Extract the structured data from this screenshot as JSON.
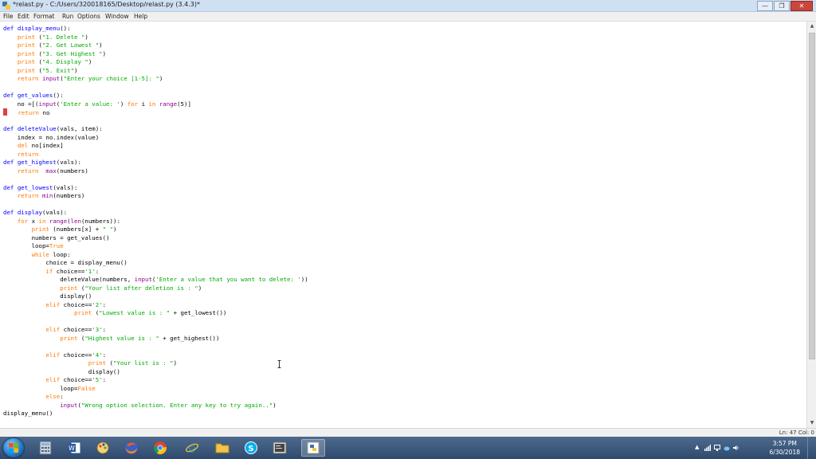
{
  "window": {
    "title": "*relast.py - C:/Users/320018165/Desktop/relast.py (3.4.3)*",
    "controls": {
      "minimize": "—",
      "maximize": "❐",
      "close": "✕"
    }
  },
  "menu": {
    "items": [
      "File",
      "Edit",
      "Format",
      "Run",
      "Options",
      "Window",
      "Help"
    ]
  },
  "editor": {
    "lines": [
      [
        [
          "def",
          "def"
        ],
        [
          "n",
          " "
        ],
        [
          "def",
          "display_menu"
        ],
        [
          "n",
          "():"
        ]
      ],
      [
        [
          "n",
          "    "
        ],
        [
          "kw",
          "print"
        ],
        [
          "n",
          " ("
        ],
        [
          "str",
          "\"1. Delete \""
        ],
        [
          "n",
          ")"
        ]
      ],
      [
        [
          "n",
          "    "
        ],
        [
          "kw",
          "print"
        ],
        [
          "n",
          " ("
        ],
        [
          "str",
          "\"2. Get Lowest \""
        ],
        [
          "n",
          ")"
        ]
      ],
      [
        [
          "n",
          "    "
        ],
        [
          "kw",
          "print"
        ],
        [
          "n",
          " ("
        ],
        [
          "str",
          "\"3. Get Highest \""
        ],
        [
          "n",
          ")"
        ]
      ],
      [
        [
          "n",
          "    "
        ],
        [
          "kw",
          "print"
        ],
        [
          "n",
          " ("
        ],
        [
          "str",
          "\"4. Display \""
        ],
        [
          "n",
          ")"
        ]
      ],
      [
        [
          "n",
          "    "
        ],
        [
          "kw",
          "print"
        ],
        [
          "n",
          " ("
        ],
        [
          "str",
          "\"5. Exit\""
        ],
        [
          "n",
          ")"
        ]
      ],
      [
        [
          "n",
          "    "
        ],
        [
          "kw",
          "return"
        ],
        [
          "n",
          " "
        ],
        [
          "bi",
          "input"
        ],
        [
          "n",
          "("
        ],
        [
          "str",
          "\"Enter your choice [1-5]: \""
        ],
        [
          "n",
          ")"
        ]
      ],
      [],
      [
        [
          "def",
          "def"
        ],
        [
          "n",
          " "
        ],
        [
          "def",
          "get_values"
        ],
        [
          "n",
          "():"
        ]
      ],
      [
        [
          "n",
          "    no =[("
        ],
        [
          "bi",
          "input"
        ],
        [
          "n",
          "("
        ],
        [
          "str",
          "'Enter a value: '"
        ],
        [
          "n",
          ") "
        ],
        [
          "kw",
          "for"
        ],
        [
          "n",
          " i "
        ],
        [
          "kw",
          "in"
        ],
        [
          "n",
          " "
        ],
        [
          "bi",
          "range"
        ],
        [
          "n",
          "(5)]"
        ]
      ],
      [
        [
          "cur",
          ""
        ],
        [
          "n",
          "   "
        ],
        [
          "kw",
          "return"
        ],
        [
          "n",
          " no"
        ]
      ],
      [],
      [
        [
          "def",
          "def"
        ],
        [
          "n",
          " "
        ],
        [
          "def",
          "deleteValue"
        ],
        [
          "n",
          "(vals, item):"
        ]
      ],
      [
        [
          "n",
          "    index = no.index(value)"
        ]
      ],
      [
        [
          "n",
          "    "
        ],
        [
          "kw",
          "del"
        ],
        [
          "n",
          " no[index]"
        ]
      ],
      [
        [
          "n",
          "    "
        ],
        [
          "kw",
          "return"
        ]
      ],
      [
        [
          "def",
          "def"
        ],
        [
          "n",
          " "
        ],
        [
          "def",
          "get_highest"
        ],
        [
          "n",
          "(vals):"
        ]
      ],
      [
        [
          "n",
          "    "
        ],
        [
          "kw",
          "return"
        ],
        [
          "n",
          "  "
        ],
        [
          "bi",
          "max"
        ],
        [
          "n",
          "(numbers)"
        ]
      ],
      [],
      [
        [
          "def",
          "def"
        ],
        [
          "n",
          " "
        ],
        [
          "def",
          "get_lowest"
        ],
        [
          "n",
          "(vals):"
        ]
      ],
      [
        [
          "n",
          "    "
        ],
        [
          "kw",
          "return"
        ],
        [
          "n",
          " "
        ],
        [
          "bi",
          "min"
        ],
        [
          "n",
          "(numbers)"
        ]
      ],
      [],
      [
        [
          "def",
          "def"
        ],
        [
          "n",
          " "
        ],
        [
          "def",
          "display"
        ],
        [
          "n",
          "(vals):"
        ]
      ],
      [
        [
          "n",
          "    "
        ],
        [
          "kw",
          "for"
        ],
        [
          "n",
          " x "
        ],
        [
          "kw",
          "in"
        ],
        [
          "n",
          " "
        ],
        [
          "bi",
          "range"
        ],
        [
          "n",
          "("
        ],
        [
          "bi",
          "len"
        ],
        [
          "n",
          "(numbers)):"
        ]
      ],
      [
        [
          "n",
          "        "
        ],
        [
          "kw",
          "print"
        ],
        [
          "n",
          " (numbers[x] + "
        ],
        [
          "str",
          "\" \""
        ],
        [
          "n",
          ")"
        ]
      ],
      [
        [
          "n",
          "        numbers = get_values()"
        ]
      ],
      [
        [
          "n",
          "        loop="
        ],
        [
          "kw",
          "True"
        ]
      ],
      [
        [
          "n",
          "        "
        ],
        [
          "kw",
          "while"
        ],
        [
          "n",
          " loop:"
        ]
      ],
      [
        [
          "n",
          "            choice = display_menu()"
        ]
      ],
      [
        [
          "n",
          "            "
        ],
        [
          "kw",
          "if"
        ],
        [
          "n",
          " choice=="
        ],
        [
          "str",
          "'1'"
        ],
        [
          "n",
          ":"
        ]
      ],
      [
        [
          "n",
          "                deleteValue(numbers, "
        ],
        [
          "bi",
          "input"
        ],
        [
          "n",
          "("
        ],
        [
          "str",
          "'Enter a value that you want to delete: '"
        ],
        [
          "n",
          "))"
        ]
      ],
      [
        [
          "n",
          "                "
        ],
        [
          "kw",
          "print"
        ],
        [
          "n",
          " ("
        ],
        [
          "str",
          "\"Your list after deletion is : \""
        ],
        [
          "n",
          ")"
        ]
      ],
      [
        [
          "n",
          "                display()"
        ]
      ],
      [
        [
          "n",
          "            "
        ],
        [
          "kw",
          "elif"
        ],
        [
          "n",
          " choice=="
        ],
        [
          "str",
          "'2'"
        ],
        [
          "n",
          ":"
        ]
      ],
      [
        [
          "n",
          "                    "
        ],
        [
          "kw",
          "print"
        ],
        [
          "n",
          " ("
        ],
        [
          "str",
          "\"Lowest value is : \""
        ],
        [
          "n",
          " + get_lowest())"
        ]
      ],
      [],
      [
        [
          "n",
          "            "
        ],
        [
          "kw",
          "elif"
        ],
        [
          "n",
          " choice=="
        ],
        [
          "str",
          "'3'"
        ],
        [
          "n",
          ":"
        ]
      ],
      [
        [
          "n",
          "                "
        ],
        [
          "kw",
          "print"
        ],
        [
          "n",
          " ("
        ],
        [
          "str",
          "\"Highest value is : \""
        ],
        [
          "n",
          " + get_highest())"
        ]
      ],
      [],
      [
        [
          "n",
          "            "
        ],
        [
          "kw",
          "elif"
        ],
        [
          "n",
          " choice=="
        ],
        [
          "str",
          "'4'"
        ],
        [
          "n",
          ":"
        ]
      ],
      [
        [
          "n",
          "                        "
        ],
        [
          "kw",
          "print"
        ],
        [
          "n",
          " ("
        ],
        [
          "str",
          "\"Your list is : \""
        ],
        [
          "n",
          ")"
        ]
      ],
      [
        [
          "n",
          "                        display()"
        ]
      ],
      [
        [
          "n",
          "            "
        ],
        [
          "kw",
          "elif"
        ],
        [
          "n",
          " choice=="
        ],
        [
          "str",
          "'5'"
        ],
        [
          "n",
          ":"
        ]
      ],
      [
        [
          "n",
          "                loop="
        ],
        [
          "kw",
          "False"
        ]
      ],
      [
        [
          "n",
          "            "
        ],
        [
          "kw",
          "else"
        ],
        [
          "n",
          ":"
        ]
      ],
      [
        [
          "n",
          "                "
        ],
        [
          "bi",
          "input"
        ],
        [
          "n",
          "("
        ],
        [
          "str",
          "\"Wrong option selection. Enter any key to try again..\""
        ],
        [
          "n",
          ")"
        ]
      ],
      [
        [
          "n",
          "display_menu()"
        ]
      ]
    ]
  },
  "status": {
    "position": "Ln: 47 Col: 0"
  },
  "taskbar": {
    "apps": [
      "windows-start",
      "file-explorer-calc",
      "word",
      "paint",
      "firefox",
      "chrome",
      "internet-explorer",
      "folder",
      "skype",
      "terminal",
      "python-idle"
    ],
    "clock": {
      "time": "3:57 PM",
      "date": "6/30/2018"
    }
  },
  "colors": {
    "keyword": "#ff7700",
    "builtin": "#900090",
    "string": "#00aa00",
    "definition": "#0000ff"
  }
}
